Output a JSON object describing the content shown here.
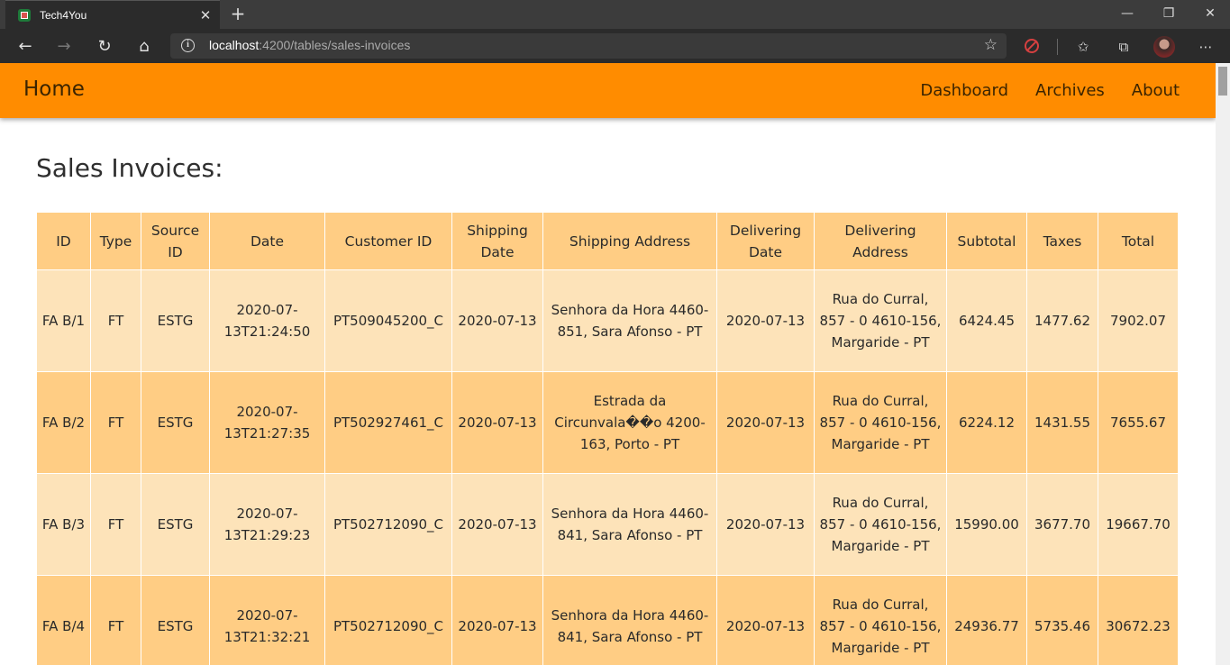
{
  "browser": {
    "tab_title": "Tech4You",
    "url_host": "localhost",
    "url_rest": ":4200/tables/sales-invoices"
  },
  "nav": {
    "brand": "Home",
    "links": [
      "Dashboard",
      "Archives",
      "About"
    ]
  },
  "page": {
    "heading": "Sales Invoices:"
  },
  "table": {
    "headers": [
      "ID",
      "Type",
      "Source ID",
      "Date",
      "Customer ID",
      "Shipping Date",
      "Shipping Address",
      "Delivering Date",
      "Delivering Address",
      "Subtotal",
      "Taxes",
      "Total"
    ],
    "rows": [
      [
        "FA B/1",
        "FT",
        "ESTG",
        "2020-07-13T21:24:50",
        "PT509045200_C",
        "2020-07-13",
        "Senhora da Hora 4460-851, Sara Afonso - PT",
        "2020-07-13",
        "Rua do Curral, 857 - 0 4610-156, Margaride - PT",
        "6424.45",
        "1477.62",
        "7902.07"
      ],
      [
        "FA B/2",
        "FT",
        "ESTG",
        "2020-07-13T21:27:35",
        "PT502927461_C",
        "2020-07-13",
        "Estrada da Circunvala��o 4200-163, Porto - PT",
        "2020-07-13",
        "Rua do Curral, 857 - 0 4610-156, Margaride - PT",
        "6224.12",
        "1431.55",
        "7655.67"
      ],
      [
        "FA B/3",
        "FT",
        "ESTG",
        "2020-07-13T21:29:23",
        "PT502712090_C",
        "2020-07-13",
        "Senhora da Hora 4460-841, Sara Afonso - PT",
        "2020-07-13",
        "Rua do Curral, 857 - 0 4610-156, Margaride - PT",
        "15990.00",
        "3677.70",
        "19667.70"
      ],
      [
        "FA B/4",
        "FT",
        "ESTG",
        "2020-07-13T21:32:21",
        "PT502712090_C",
        "2020-07-13",
        "Senhora da Hora 4460-841, Sara Afonso - PT",
        "2020-07-13",
        "Rua do Curral, 857 - 0 4610-156, Margaride - PT",
        "24936.77",
        "5735.46",
        "30672.23"
      ]
    ]
  }
}
